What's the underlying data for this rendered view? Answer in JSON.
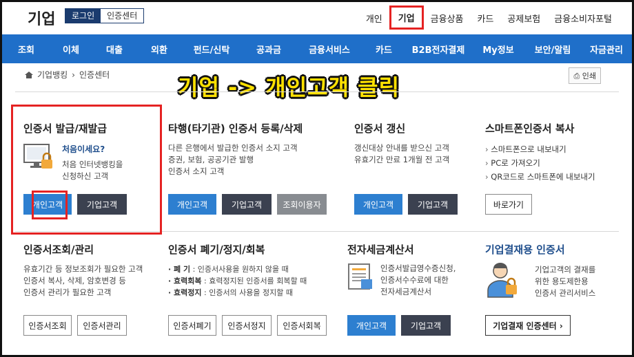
{
  "header": {
    "logo": "기업",
    "login": "로그인",
    "cert_center": "인증센터",
    "nav": [
      "개인",
      "기업",
      "금융상품",
      "카드",
      "공제보험",
      "금융소비자포털"
    ],
    "active_nav": "기업"
  },
  "main_nav": [
    "조회",
    "이체",
    "대출",
    "외환",
    "펀드/신탁",
    "공과금",
    "금융서비스",
    "카드",
    "B2B전자결제",
    "My정보",
    "보안/알림",
    "자금관리"
  ],
  "breadcrumb": {
    "home": "기업뱅킹",
    "current": "인증센터"
  },
  "print": "인쇄",
  "annotation": "기업 -> 개인고객 클릭",
  "cards": {
    "issue": {
      "title": "인증서 발급/재발급",
      "sub": "처음이세요?",
      "desc1": "처음 인터넷뱅킹을",
      "desc2": "신청하신 고객",
      "btn1": "개인고객",
      "btn2": "기업고객"
    },
    "other": {
      "title": "타행(타기관) 인증서 등록/삭제",
      "desc1": "다른 은행에서 발급한 인증서 소지 고객",
      "desc2": "증권, 보험, 공공기관 발행",
      "desc3": "인증서 소지 고객",
      "btn1": "개인고객",
      "btn2": "기업고객",
      "btn3": "조회이용자"
    },
    "renew": {
      "title": "인증서 갱신",
      "desc1": "갱신대상 안내를 받으신 고객",
      "desc2": "유효기간 만료 1개월 전 고객",
      "btn1": "개인고객",
      "btn2": "기업고객"
    },
    "smart": {
      "title": "스마트폰인증서 복사",
      "items": [
        "스마트폰으로 내보내기",
        "PC로 가져오기",
        "QR코드로 스마트폰에 내보내기"
      ],
      "btn": "바로가기"
    },
    "manage": {
      "title": "인증서조회/관리",
      "desc1": "유효기간 등 정보조회가 필요한 고객",
      "desc2": "인증서 복사, 삭제, 암호변경 등",
      "desc3": "인증서 관리가 필요한 고객",
      "btn1": "인증서조회",
      "btn2": "인증서관리"
    },
    "revoke": {
      "title": "인증서 폐기/정지/회복",
      "rows": [
        {
          "k": "· 폐      기",
          "v": " : 인증서사용을 원하지 않을 때"
        },
        {
          "k": "· 효력회복",
          "v": " : 효력정지된 인증서를 회복할 때"
        },
        {
          "k": "· 효력정지",
          "v": " : 인증서의 사용을 정지할 때"
        }
      ],
      "btn1": "인증서폐기",
      "btn2": "인증서정지",
      "btn3": "인증서회복"
    },
    "tax": {
      "title": "전자세금계산서",
      "desc1": "인증서발급영수증신청,",
      "desc2": "인증서수수료에 대한",
      "desc3": "전자세금계산서",
      "btn1": "개인고객",
      "btn2": "기업고객"
    },
    "pay": {
      "title": "기업결재용 인증서",
      "desc1": "기업고객의 결재를",
      "desc2": "위한 용도제한용",
      "desc3": "인증서 관리서비스",
      "btn": "기업결재 인증센터 ›"
    }
  },
  "colors": {
    "nav_blue": "#1f6fc9",
    "btn_blue": "#2d7fd0",
    "btn_dark": "#3b4150",
    "highlight_red": "#e52222",
    "annotation_yellow": "#ffe100"
  }
}
